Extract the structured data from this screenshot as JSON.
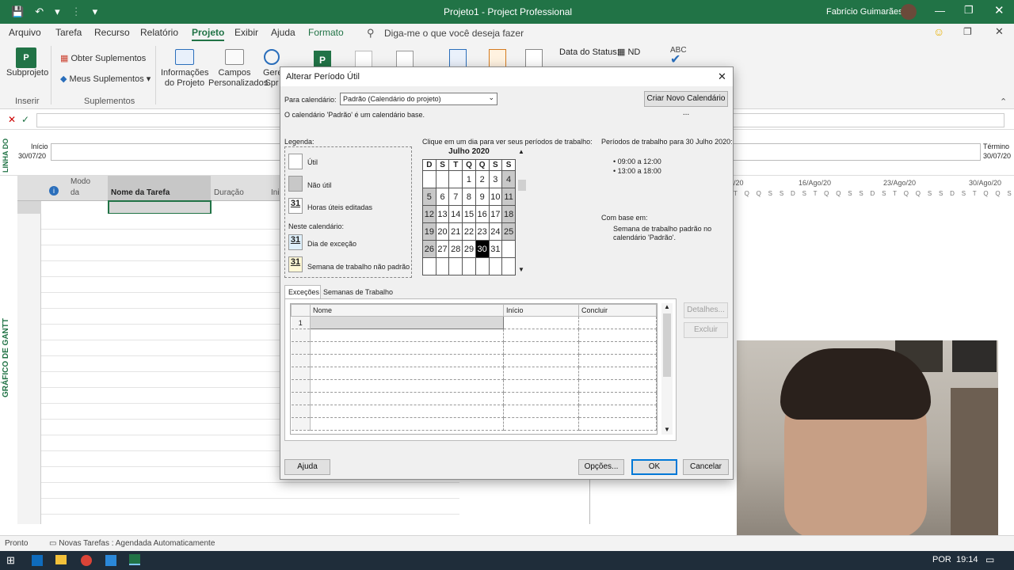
{
  "window": {
    "title": "Projeto1  -  Project Professional",
    "user": "Fabrício Guimarães"
  },
  "qat": {
    "save": "💾",
    "undo": "↶",
    "dd": "▾",
    "sep": "⋮",
    "more": "▾"
  },
  "tabs": [
    "Arquivo",
    "Tarefa",
    "Recurso",
    "Relatório",
    "Projeto",
    "Exibir",
    "Ajuda",
    "Formato"
  ],
  "active_tab": "Projeto",
  "tell_me": "Diga-me o que você deseja fazer",
  "ribbon": {
    "subprojeto": "Subprojeto",
    "obter": "Obter Suplementos",
    "meus": "Meus Suplementos",
    "info1": "Informações",
    "info2": "do Projeto",
    "campos1": "Campos",
    "campos2": "Personalizados",
    "gere": "Gere",
    "spr": "Spr",
    "data_status": "Data do Status:",
    "nd": "ND",
    "abc": "ABC",
    "group_inserir": "Inserir",
    "group_suplementos": "Suplementos"
  },
  "timeline": {
    "side": "LINHA DO",
    "inicio_lbl": "Início",
    "inicio_val": "30/07/20",
    "termino_lbl": "Término",
    "termino_val": "30/07/20"
  },
  "grid": {
    "col_modo": "Modo",
    "col_modo2": "da",
    "col_nome": "Nome da Tarefa",
    "col_dur": "Duração",
    "col_ini": "Ini",
    "side": "GRÁFICO DE GANTT"
  },
  "gantt": {
    "weeks": [
      "/20",
      "16/Ago/20",
      "23/Ago/20",
      "30/Ago/20"
    ],
    "days": "T Q Q S S D S T Q Q S S D S T Q Q S S D S T Q Q S S D S"
  },
  "status": {
    "ready": "Pronto",
    "new_tasks": "Novas Tarefas : Agendada Automaticamente"
  },
  "taskbar": {
    "lang": "POR",
    "time": "19:14"
  },
  "dialog": {
    "title": "Alterar Período Útil",
    "for_cal": "Para calendário:",
    "cal_value": "Padrão (Calendário do projeto)",
    "create_new": "Criar Novo Calendário ...",
    "base_info": "O calendário 'Padrão' é um calendário base.",
    "legend": "Legenda:",
    "util": "Útil",
    "nao_util": "Não útil",
    "horas_ed": "Horas úteis editadas",
    "neste": "Neste calendário:",
    "dia_exc": "Dia de exceção",
    "semana_np": "Semana de trabalho não padrão",
    "n31": "31",
    "click_day": "Clique em um dia para ver seus períodos de trabalho:",
    "month": "Julho 2020",
    "dow": [
      "D",
      "S",
      "T",
      "Q",
      "Q",
      "S",
      "S"
    ],
    "weeks": [
      [
        "",
        "",
        "",
        "1",
        "2",
        "3",
        "4"
      ],
      [
        "5",
        "6",
        "7",
        "8",
        "9",
        "10",
        "11"
      ],
      [
        "12",
        "13",
        "14",
        "15",
        "16",
        "17",
        "18"
      ],
      [
        "19",
        "20",
        "21",
        "22",
        "23",
        "24",
        "25"
      ],
      [
        "26",
        "27",
        "28",
        "29",
        "30",
        "31",
        ""
      ],
      [
        "",
        "",
        "",
        "",
        "",
        "",
        ""
      ]
    ],
    "periods_title": "Períodos de trabalho para 30 Julho 2020:",
    "period1": "• 09:00 a 12:00",
    "period2": "• 13:00 a 18:00",
    "based_on": "Com base em:",
    "based_text1": "Semana de trabalho padrão no",
    "based_text2": "calendário 'Padrão'.",
    "tab_exc": "Exceções",
    "tab_week": "Semanas de Trabalho",
    "col_nome": "Nome",
    "col_inicio": "Início",
    "col_concluir": "Concluir",
    "row1": "1",
    "detalhes": "Detalhes...",
    "excluir": "Excluir",
    "ajuda": "Ajuda",
    "opcoes": "Opções...",
    "ok": "OK",
    "cancelar": "Cancelar"
  }
}
